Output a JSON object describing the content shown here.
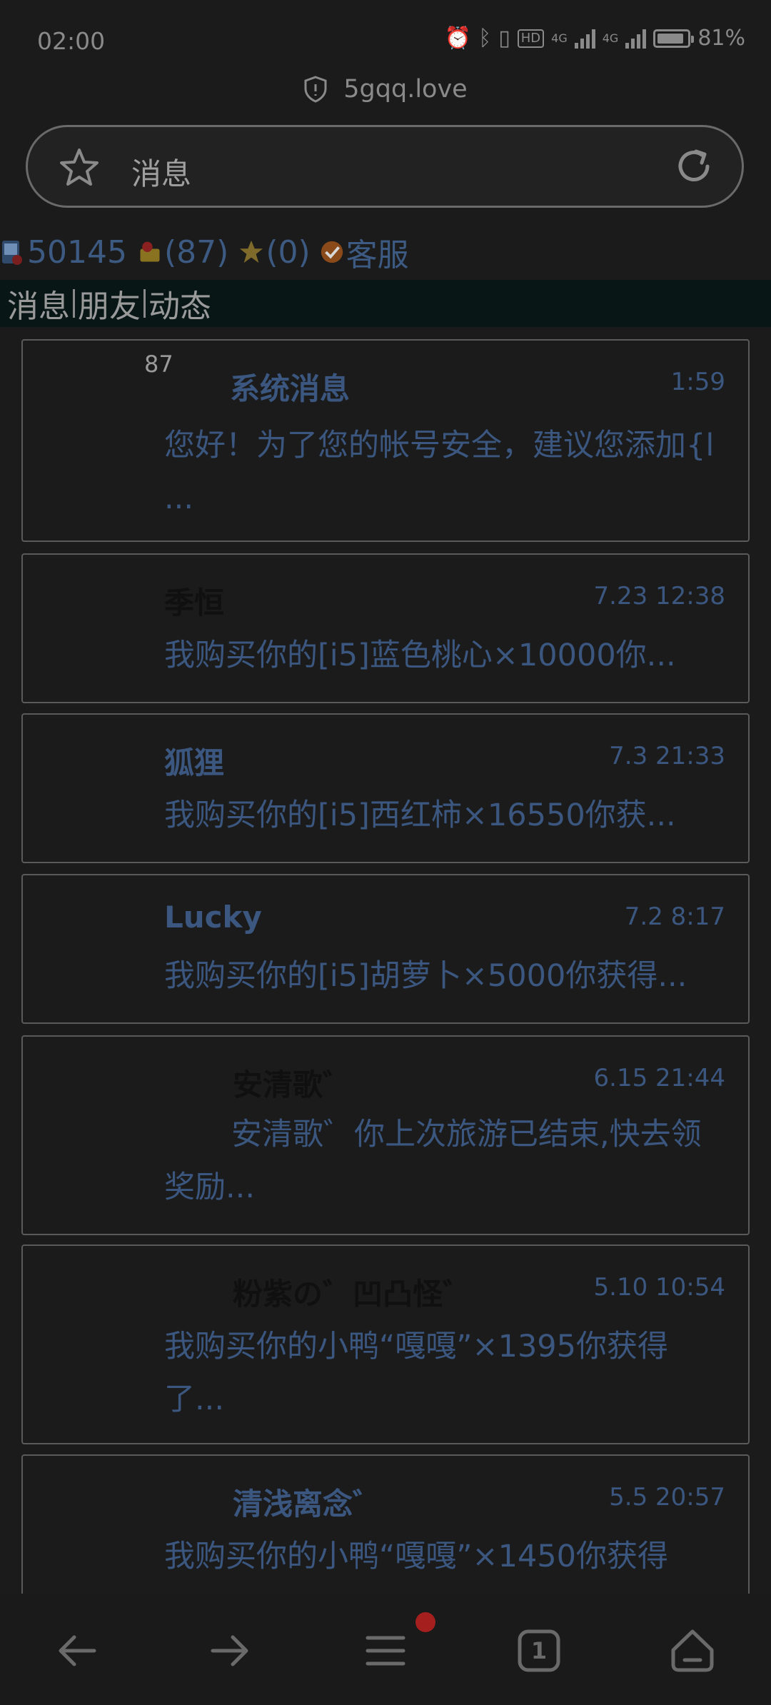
{
  "status": {
    "time": "02:00",
    "battery": "81%",
    "network": "4G",
    "hd": "HD"
  },
  "browser": {
    "domain": "5gqq.love",
    "url_text": "消息"
  },
  "account": {
    "id": "50145",
    "bag_count": "(87)",
    "star_count": "(0)",
    "service": "客服"
  },
  "nav": {
    "tab1": "消息",
    "tab2": "朋友",
    "tab3": "动态"
  },
  "messages": [
    {
      "badge": "87",
      "name": "系统消息",
      "time": "1:59",
      "preview": "您好！为了您的帐号安全，建议您添加{l ..."
    },
    {
      "name": "季恒",
      "time": "7.23 12:38",
      "preview": "我购买你的[i5]蓝色桃心×10000你..."
    },
    {
      "name": "狐狸",
      "time": "7.3 21:33",
      "preview": "我购买你的[i5]西红柿×16550你获..."
    },
    {
      "name": "Lucky",
      "time": "7.2 8:17",
      "preview": "我购买你的[i5]胡萝卜×5000你获得..."
    },
    {
      "name": "安清歌゛",
      "time": "6.15 21:44",
      "preview": "安清歌゛你上次旅游已结束,快去领奖励..."
    },
    {
      "name": "粉紫の゛凹凸怪゛",
      "time": "5.10 10:54",
      "preview": "我购买你的小鸭“嘎嘎”×1395你获得了..."
    },
    {
      "name": "清浅离念゛",
      "time": "5.5 20:57",
      "preview": "我购买你的小鸭“嘎嘎”×1450你获得"
    }
  ],
  "tabs_count": "1"
}
